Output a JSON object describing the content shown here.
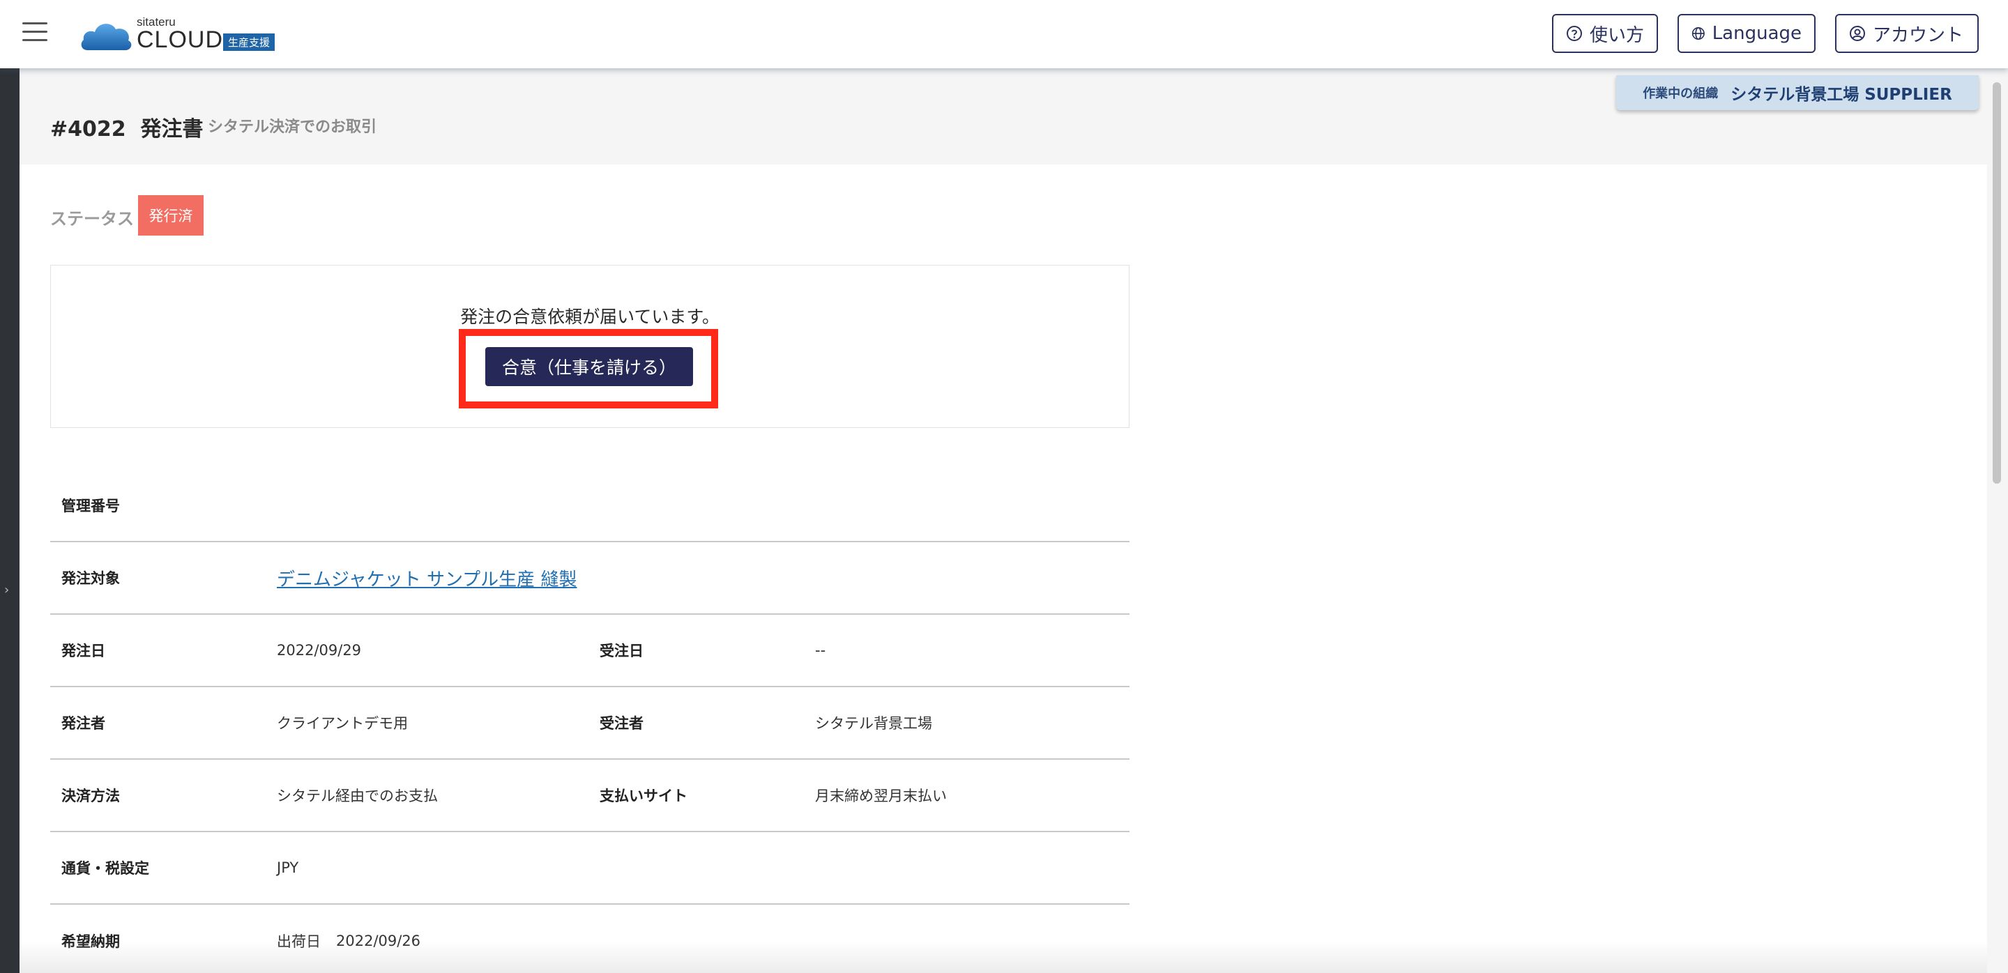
{
  "header": {
    "logo_small": "sitateru",
    "logo_big": "CLOUD",
    "logo_tag": "生産支援",
    "help_label": "使い方",
    "language_label": "Language",
    "account_label": "アカウント"
  },
  "org": {
    "label": "作業中の組織",
    "name": "シタテル背景工場 SUPPLIER"
  },
  "page": {
    "title": "#4022  発注書",
    "subtitle": "シタテル決済でのお取引"
  },
  "status": {
    "label": "ステータス",
    "badge": "発行済",
    "badge_color": "#f26e62"
  },
  "agreement": {
    "message": "発注の合意依頼が届いています。",
    "button_label": "合意（仕事を請ける）",
    "button_color": "#262857",
    "highlight_color": "#ff2a1a"
  },
  "details": {
    "mgmt_no_label": "管理番号",
    "mgmt_no_value": "",
    "target_label": "発注対象",
    "target_value": "デニムジャケット サンプル生産 縫製",
    "order_date_label": "発注日",
    "order_date_value": "2022/09/29",
    "accept_date_label": "受注日",
    "accept_date_value": "--",
    "orderer_label": "発注者",
    "orderer_value": "クライアントデモ用",
    "receiver_label": "受注者",
    "receiver_value": "シタテル背景工場",
    "payment_label": "決済方法",
    "payment_value": "シタテル経由でのお支払",
    "site_label": "支払いサイト",
    "site_value": "月末締め翌月末払い",
    "currency_label": "通貨・税設定",
    "currency_value": "JPY",
    "delivery_label": "希望納期",
    "delivery_type": "出荷日",
    "delivery_value": "2022/09/26"
  }
}
